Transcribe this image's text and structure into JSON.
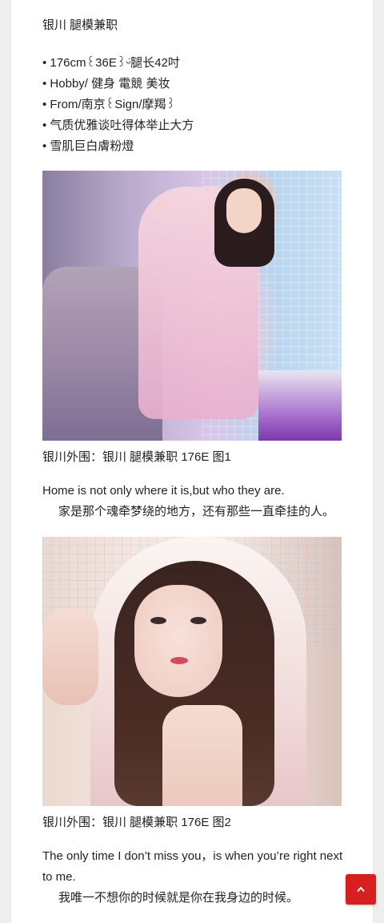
{
  "post": {
    "title": "银川 腿模兼职",
    "bullets": [
      "176cm꒰36E꒱ᵕ̈腿长42吋",
      "Hobby/ 健身 電競 美妆",
      "From/南京꒰Sign/摩羯꒱",
      "气质优雅谈吐得体举止大方",
      "雪肌巨白膚粉燈"
    ],
    "figures": [
      {
        "caption": "银川外围：银川 腿模兼职 176E 图1"
      },
      {
        "caption": "银川外围：银川 腿模兼职 176E 图2"
      }
    ],
    "paragraphs": [
      {
        "en": "Home is not only where it is,but who they are.",
        "zh": "家是那个魂牵梦绕的地方，还有那些一直牵挂的人。"
      },
      {
        "en": "The only time I don’t miss you，is when you’re right next to me.",
        "zh": "我唯一不想你的时候就是你在我身边的时候。"
      }
    ]
  },
  "back_to_top": {
    "icon": "chevron-up-icon",
    "color": "#d71f1f"
  }
}
